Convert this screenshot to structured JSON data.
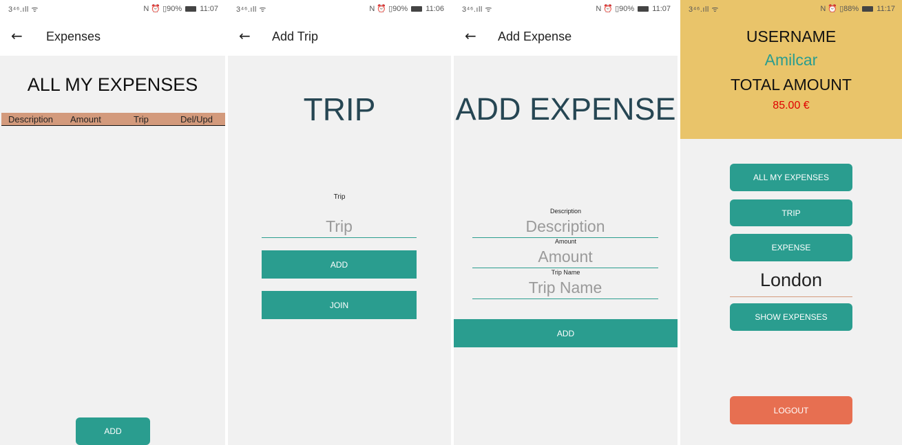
{
  "status_bars": [
    {
      "left": "3⁴⁶.ıll ᯤ",
      "right": "N ⏰ ▯90%",
      "time": "11:07"
    },
    {
      "left": "3⁴⁶.ıll ᯤ",
      "right": "N ⏰ ▯90%",
      "time": "11:06"
    },
    {
      "left": "3⁴⁶.ıll ᯤ",
      "right": "N ⏰ ▯90%",
      "time": "11:07"
    },
    {
      "left": "3⁴⁶.ıll ᯤ",
      "right": "N ⏰ ▯88%",
      "time": "11:17"
    }
  ],
  "expenses_screen": {
    "title": "Expenses",
    "heading": "ALL MY EXPENSES",
    "columns": [
      "Description",
      "Amount",
      "Trip",
      "Del/Upd"
    ],
    "add_label": "ADD"
  },
  "add_trip_screen": {
    "title": "Add Trip",
    "heading": "TRIP",
    "field_label": "Trip",
    "field_placeholder": "Trip",
    "add_label": "ADD",
    "join_label": "JOIN"
  },
  "add_expense_screen": {
    "title": "Add Expense",
    "heading": "ADD EXPENSE",
    "description_label": "Description",
    "description_placeholder": "Description",
    "amount_label": "Amount",
    "amount_placeholder": "Amount",
    "trip_name_label": "Trip Name",
    "trip_name_placeholder": "Trip Name",
    "add_label": "ADD"
  },
  "home_screen": {
    "username_label": "USERNAME",
    "username": "Amilcar",
    "total_label": "TOTAL AMOUNT",
    "total_value": "85.00 €",
    "all_expenses_label": "ALL MY EXPENSES",
    "trip_label": "TRIP",
    "expense_label": "EXPENSE",
    "city": "London",
    "show_expenses_label": "SHOW EXPENSES",
    "logout_label": "LOGOUT"
  },
  "colors": {
    "teal": "#2a9d8f",
    "header_yellow": "#e9c46a",
    "table_header": "#d39a7c",
    "logout": "#e76f51",
    "total_red": "#e00000",
    "title_dark": "#264653"
  },
  "icons": {
    "back": "back-arrow-icon",
    "signal": "signal-icon",
    "wifi": "wifi-icon",
    "battery": "battery-icon",
    "alarm": "alarm-icon",
    "nfc": "nfc-icon"
  }
}
